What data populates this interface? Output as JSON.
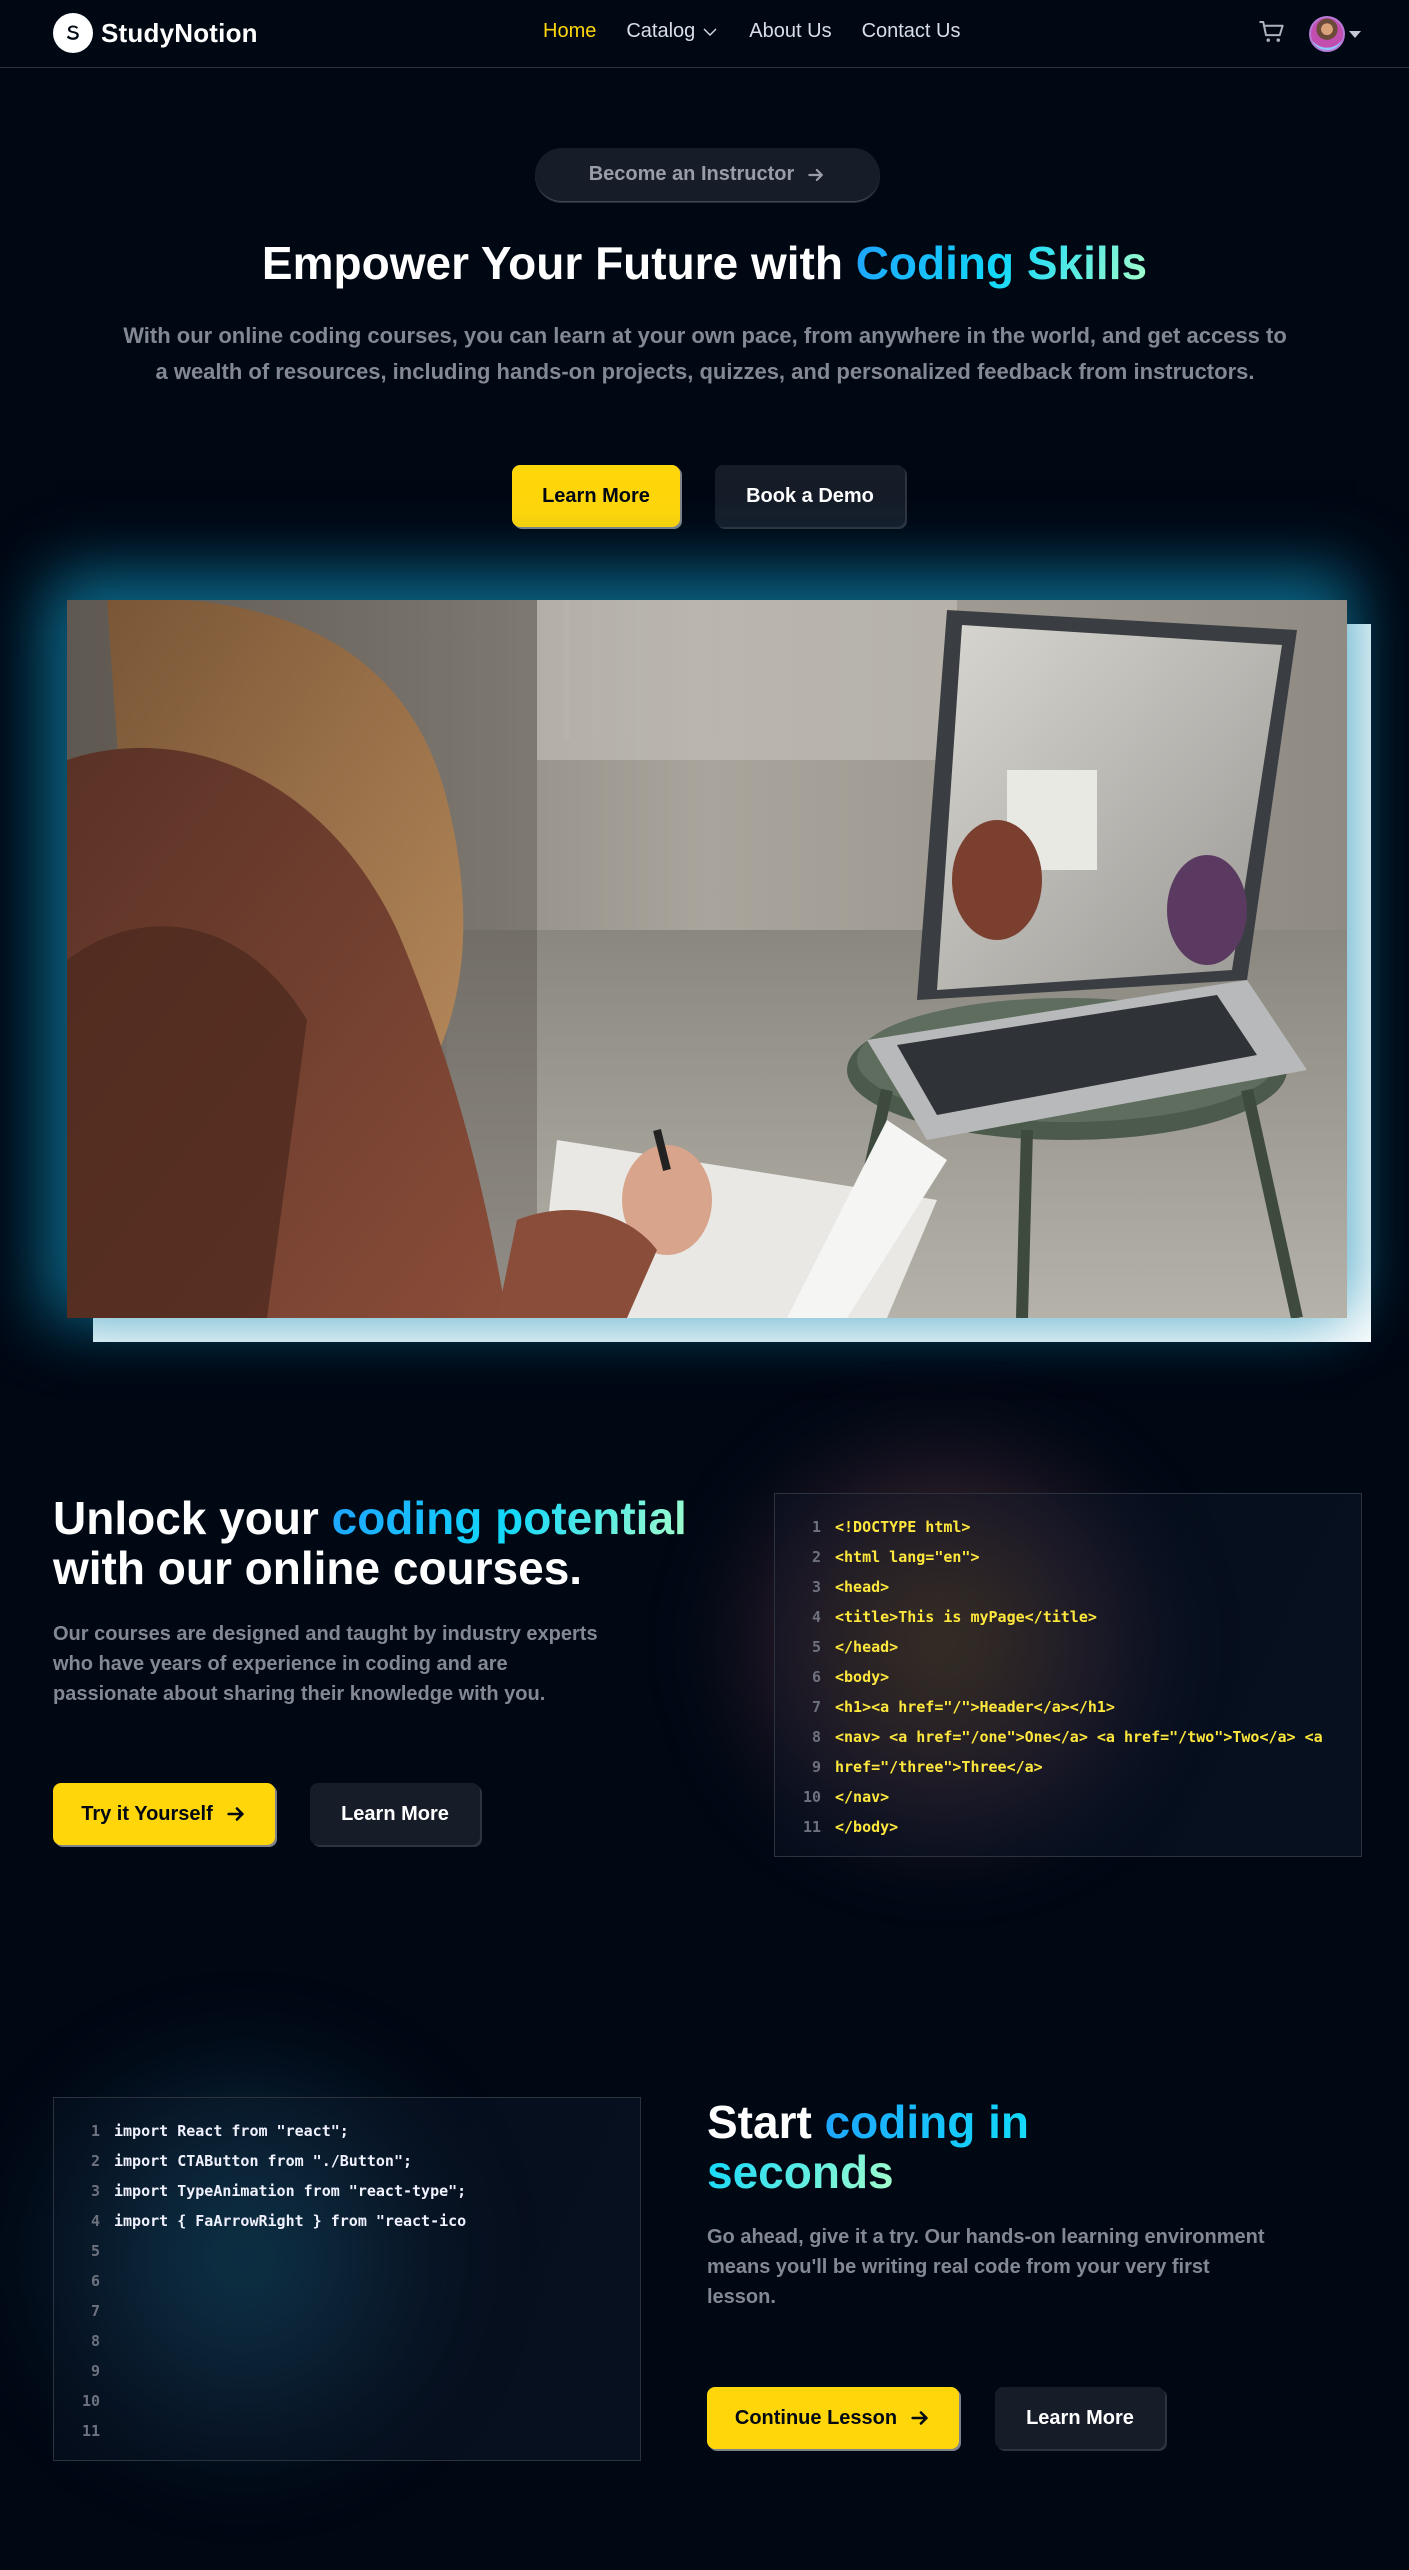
{
  "navbar": {
    "logo_text": "StudyNotion",
    "links": [
      {
        "label": "Home",
        "active": true
      },
      {
        "label": "Catalog"
      },
      {
        "label": "About Us"
      },
      {
        "label": "Contact Us"
      }
    ]
  },
  "hero": {
    "instructor_button": "Become an Instructor",
    "title_prefix": "Empower Your Future with ",
    "title_highlight": "Coding Skills",
    "subtitle": "With our online coding courses, you can learn at your own pace, from anywhere in the world, and get access to a wealth of resources, including hands-on projects, quizzes, and personalized feedback from instructors.",
    "primary_button": "Learn More",
    "secondary_button": "Book a Demo"
  },
  "section1": {
    "title_prefix": "Unlock your ",
    "title_highlight": "coding potential",
    "title_suffix": "with our online courses.",
    "subtitle": "Our courses are designed and taught by industry experts who have years of experience in coding and are passionate about sharing their knowledge with you.",
    "primary_button": "Try it Yourself",
    "secondary_button": "Learn More",
    "code_line_numbers": [
      "1",
      "2",
      "3",
      "4",
      "5",
      "6",
      "7",
      "8",
      "9",
      "10",
      "11"
    ],
    "code_lines": [
      "<!DOCTYPE html>",
      "<html lang=\"en\">",
      "<head>",
      "<title>This is myPage</title>",
      "</head>",
      "<body>",
      "<h1><a href=\"/\">Header</a></h1>",
      "<nav> <a href=\"/one\">One</a> <a href=\"/two\">Two</a> <a",
      "href=\"/three\">Three</a>",
      "</nav>",
      "</body>"
    ]
  },
  "section2": {
    "title_prefix": "Start ",
    "title_highlight": "coding in seconds",
    "subtitle": "Go ahead, give it a try. Our hands-on learning environment means you'll be writing real code from your very first lesson.",
    "primary_button": "Continue Lesson",
    "secondary_button": "Learn More",
    "code_line_numbers": [
      "1",
      "2",
      "3",
      "4",
      "5",
      "6",
      "7",
      "8",
      "9",
      "10",
      "11"
    ],
    "code_lines": [
      "import React from \"react\";",
      "import CTAButton from \"./Button\";",
      "import TypeAnimation from \"react-type\";",
      "import { FaArrowRight } from \"react-ico",
      "",
      "",
      "",
      "",
      "",
      "",
      ""
    ]
  },
  "colors": {
    "background": "#000814",
    "accent_yellow": "#FFD60A",
    "accent_cyan": "#12D8FA",
    "muted_text": "#838894"
  }
}
